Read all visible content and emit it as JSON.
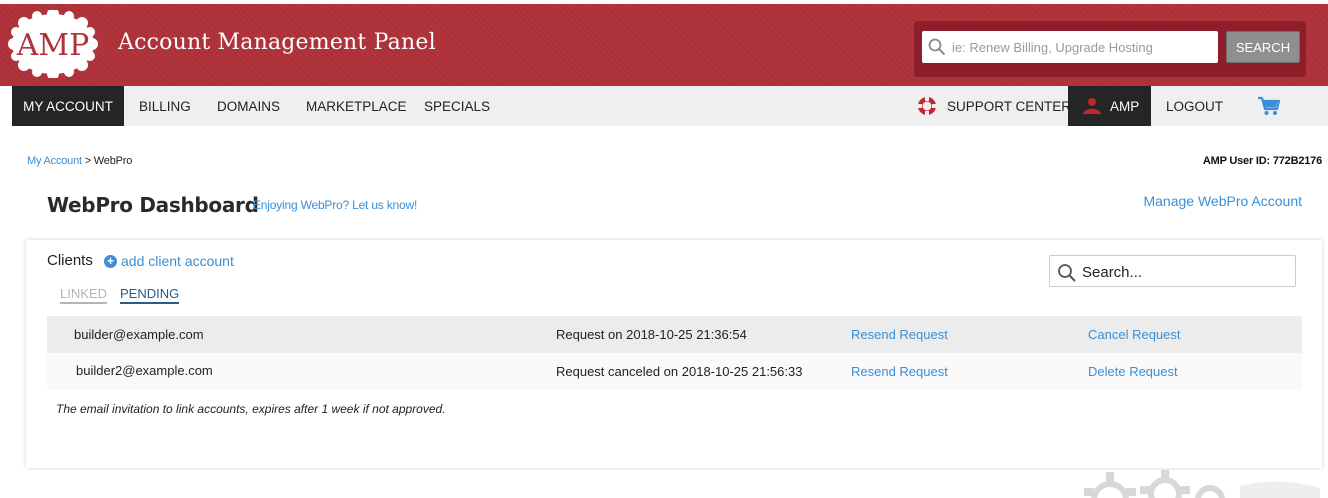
{
  "header": {
    "logo_text": "AMP",
    "title": "Account Management Panel",
    "search": {
      "placeholder": "ie: Renew Billing, Upgrade Hosting",
      "button_label": "SEARCH"
    },
    "colors": {
      "brand": "#b1313a",
      "brand_dark": "#8c1f29"
    }
  },
  "nav": {
    "items": [
      {
        "label": "MY ACCOUNT"
      },
      {
        "label": "BILLING"
      },
      {
        "label": "DOMAINS"
      },
      {
        "label": "MARKETPLACE"
      },
      {
        "label": "SPECIALS"
      }
    ],
    "right": {
      "support_label": "SUPPORT CENTER",
      "support_icon": "lifebuoy-icon",
      "amp_label": "AMP",
      "amp_icon": "user-icon",
      "logout_label": "LOGOUT",
      "cart_icon": "cart-icon"
    }
  },
  "breadcrumb": {
    "root": "My Account",
    "separator": " > ",
    "current": "WebPro"
  },
  "user_id": "AMP User ID: 772B2176",
  "page": {
    "title": "WebPro Dashboard",
    "feedback_link": "Enjoying WebPro? Let us know!",
    "manage_link": "Manage WebPro Account"
  },
  "clients": {
    "label": "Clients",
    "add_link": "add client account",
    "search_placeholder": "Search...",
    "tabs": [
      {
        "label": "LINKED",
        "active": false
      },
      {
        "label": "PENDING",
        "active": true
      }
    ],
    "rows": [
      {
        "email": "builder@example.com",
        "status": "Request on 2018-10-25 21:36:54",
        "action1": "Resend Request",
        "action2": "Cancel Request"
      },
      {
        "email": "builder2@example.com",
        "status": "Request canceled on 2018-10-25 21:56:33",
        "action1": "Resend Request",
        "action2": "Delete Request"
      }
    ],
    "note": "The email invitation to link accounts, expires after 1 week if not approved."
  }
}
